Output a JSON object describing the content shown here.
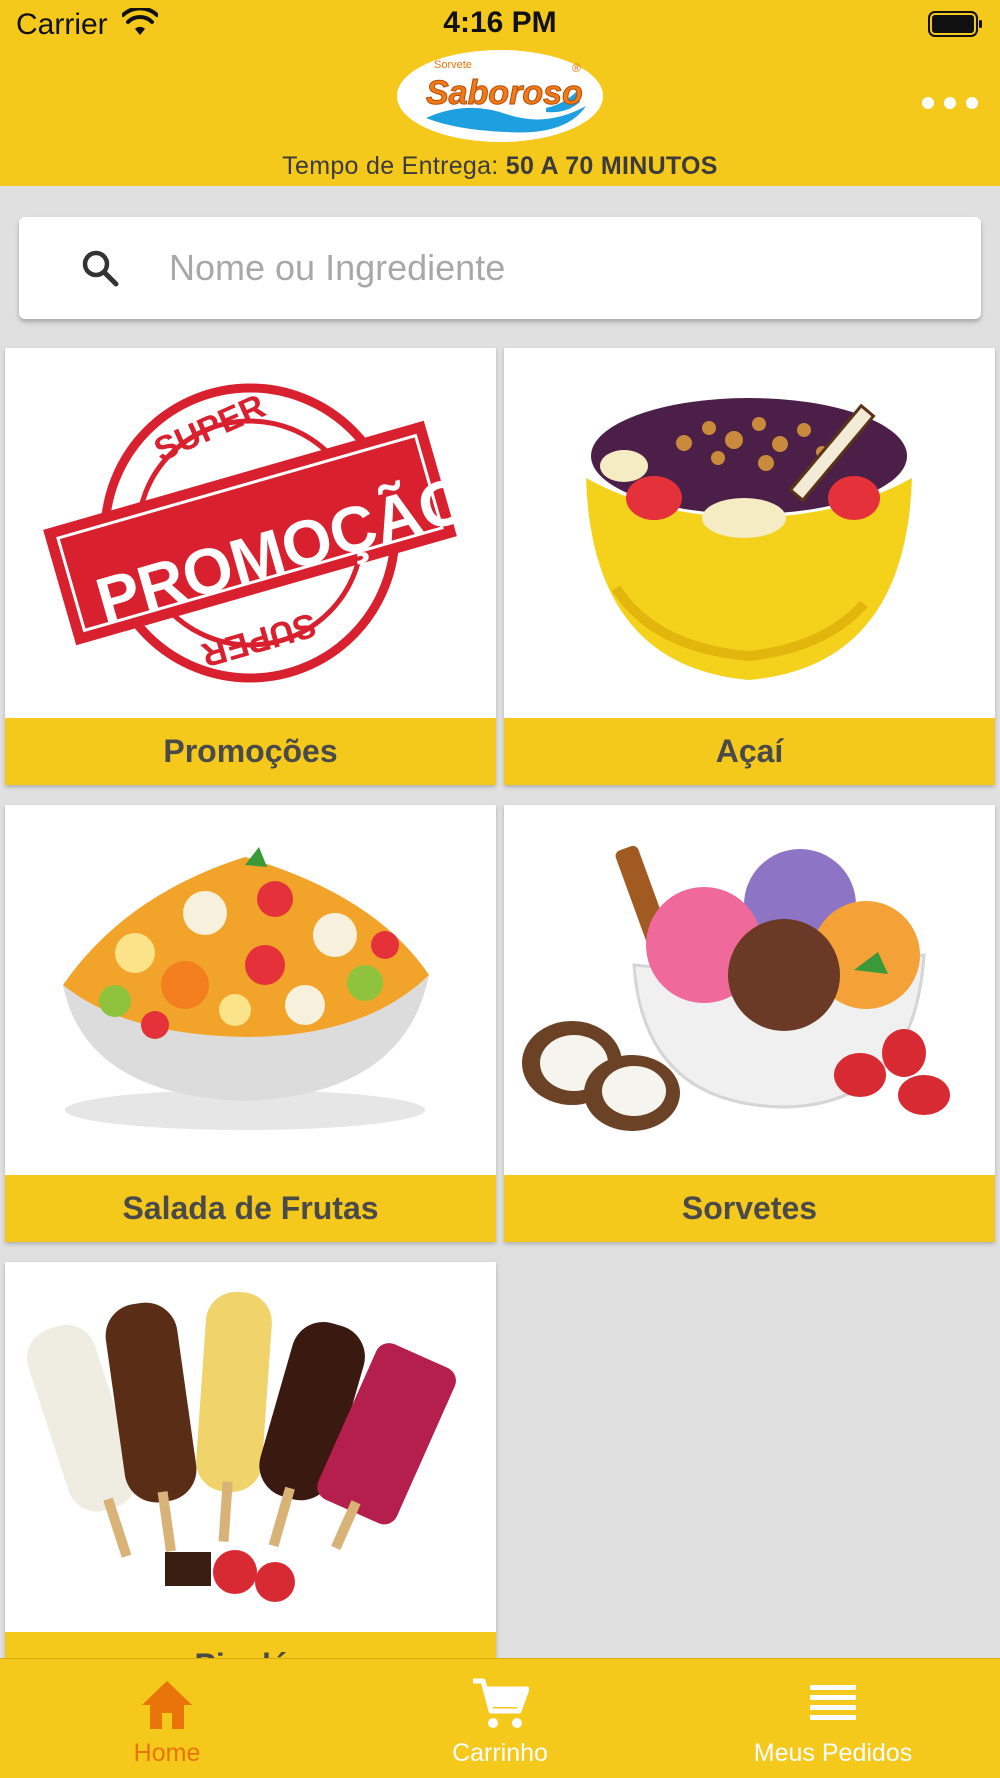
{
  "status_bar": {
    "carrier": "Carrier",
    "time": "4:16 PM"
  },
  "header": {
    "logo": {
      "top_text": "Sorvete",
      "brand_text": "Saboroso",
      "mark": "®"
    },
    "delivery_label": "Tempo de Entrega:",
    "delivery_value": "50 A 70 MINUTOS",
    "more_icon": "ellipsis-icon"
  },
  "search": {
    "placeholder": "Nome ou Ingrediente",
    "value": "",
    "icon": "search-icon"
  },
  "categories": [
    {
      "label": "Promoções",
      "image": "super-promocao-stamp"
    },
    {
      "label": "Açaí",
      "image": "acai-bowl"
    },
    {
      "label": "Salada de Frutas",
      "image": "fruit-salad-bowl"
    },
    {
      "label": "Sorvetes",
      "image": "ice-cream-scoops"
    },
    {
      "label": "Picolés",
      "image": "popsicles"
    }
  ],
  "tabbar": {
    "tabs": [
      {
        "label": "Home",
        "icon": "home-icon",
        "active": true
      },
      {
        "label": "Carrinho",
        "icon": "cart-icon",
        "active": false
      },
      {
        "label": "Meus Pedidos",
        "icon": "list-icon",
        "active": false
      }
    ]
  },
  "colors": {
    "brand_yellow": "#f5c81c",
    "active_tab": "#e8740a",
    "label_text": "#4a4a4a",
    "background": "#e0e0e0"
  }
}
